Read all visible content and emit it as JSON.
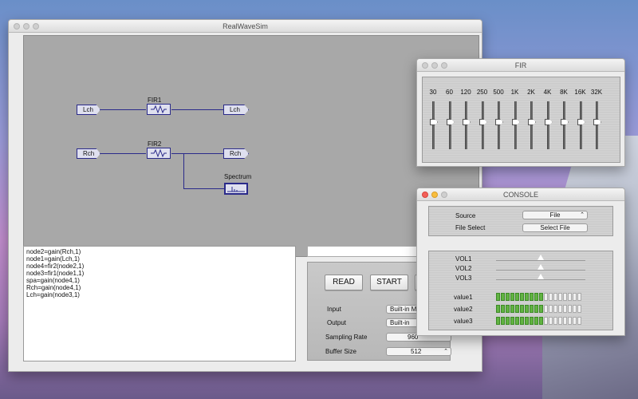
{
  "main_window": {
    "title": "RealWaveSim",
    "diagram": {
      "nodes": {
        "lch_in": "Lch",
        "fir1": "FIR1",
        "lch_out": "Lch",
        "rch_in": "Rch",
        "fir2": "FIR2",
        "rch_out": "Rch",
        "spectrum": "Spectrum"
      }
    },
    "code_lines": [
      "node2=gain(Rch,1)",
      "node1=gain(Lch,1)",
      "node4=fir2(node2,1)",
      "node3=fir1(node1,1)",
      "spa=gain(node4,1)",
      "Rch=gain(node4,1)",
      "Lch=gain(node3,1)"
    ],
    "controls": {
      "read_label": "READ",
      "start_label": "START",
      "input_label": "Input",
      "input_value": "Built-in M",
      "output_label": "Output",
      "output_value": "Built-in",
      "sampling_label": "Sampling Rate",
      "sampling_value": "960",
      "buffer_label": "Buffer Size",
      "buffer_value": "512"
    }
  },
  "fir_window": {
    "title": "FIR",
    "bands": [
      "30",
      "60",
      "120",
      "250",
      "500",
      "1K",
      "2K",
      "4K",
      "8K",
      "16K",
      "32K"
    ]
  },
  "console_window": {
    "title": "CONSOLE",
    "source_label": "Source",
    "source_value": "File",
    "file_select_label": "File Select",
    "select_file_button": "Select File",
    "volumes": [
      {
        "label": "VOL1",
        "level": 0.5
      },
      {
        "label": "VOL2",
        "level": 0.5
      },
      {
        "label": "VOL3",
        "level": 0.5
      }
    ],
    "meters": [
      {
        "label": "value1",
        "lit": 10,
        "total": 18
      },
      {
        "label": "value2",
        "lit": 10,
        "total": 18
      },
      {
        "label": "value3",
        "lit": 10,
        "total": 18
      }
    ]
  },
  "colors": {
    "wire": "#2a2a8a",
    "meter_on": "#62b342",
    "close_button": "#f25f58"
  }
}
